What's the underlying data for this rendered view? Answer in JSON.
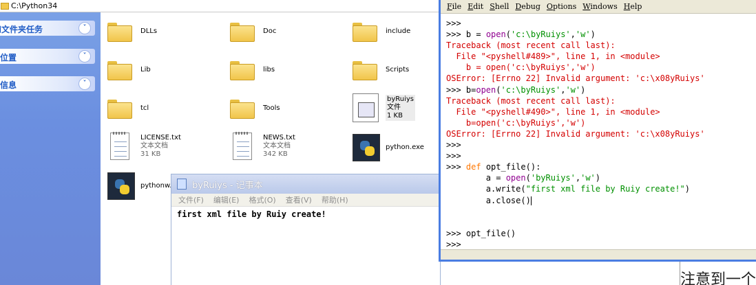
{
  "explorer": {
    "address": "C:\\Python34",
    "tasks": [
      {
        "label": "件和文件夹任务"
      },
      {
        "label": "其它位置"
      },
      {
        "label": "详细信息"
      }
    ],
    "files": [
      {
        "name": "DLLs",
        "type": "folder"
      },
      {
        "name": "Doc",
        "type": "folder"
      },
      {
        "name": "include",
        "type": "folder"
      },
      {
        "name": "Lib",
        "type": "folder"
      },
      {
        "name": "libs",
        "type": "folder"
      },
      {
        "name": "Scripts",
        "type": "folder"
      },
      {
        "name": "tcl",
        "type": "folder"
      },
      {
        "name": "Tools",
        "type": "folder"
      },
      {
        "name": "byRuiys",
        "type": "file",
        "kind": "文件",
        "size": "1 KB"
      },
      {
        "name": "LICENSE.txt",
        "type": "text",
        "kind": "文本文档",
        "size": "31 KB"
      },
      {
        "name": "NEWS.txt",
        "type": "text",
        "kind": "文本文档",
        "size": "342 KB"
      },
      {
        "name": "python.exe",
        "type": "exe"
      },
      {
        "name": "pythonw.",
        "type": "exe"
      }
    ]
  },
  "notepad": {
    "title": "byRuiys - 记事本",
    "menu": [
      "文件(F)",
      "编辑(E)",
      "格式(O)",
      "查看(V)",
      "帮助(H)"
    ],
    "content": "first xml file by Ruiy create!"
  },
  "idle": {
    "menu": [
      "File",
      "Edit",
      "Shell",
      "Debug",
      "Options",
      "Windows",
      "Help"
    ],
    "lines": [
      {
        "p": ">>>",
        "t": ""
      },
      {
        "p": ">>> ",
        "t": "b = open('c:\\byRuiys','w')"
      },
      {
        "p": "",
        "t": "Traceback (most recent call last):"
      },
      {
        "p": "",
        "t": "  File \"<pyshell#489>\", line 1, in <module>"
      },
      {
        "p": "",
        "t": "    b = open('c:\\byRuiys','w')"
      },
      {
        "p": "",
        "t": "OSError: [Errno 22] Invalid argument: 'c:\\x08yRuiys'"
      },
      {
        "p": ">>> ",
        "t": "b=open('c:\\byRuiys','w')"
      },
      {
        "p": "",
        "t": "Traceback (most recent call last):"
      },
      {
        "p": "",
        "t": "  File \"<pyshell#490>\", line 1, in <module>"
      },
      {
        "p": "",
        "t": "    b=open('c:\\byRuiys','w')"
      },
      {
        "p": "",
        "t": "OSError: [Errno 22] Invalid argument: 'c:\\x08yRuiys'"
      },
      {
        "p": ">>>",
        "t": ""
      },
      {
        "p": ">>>",
        "t": ""
      },
      {
        "p": ">>> ",
        "t": "def opt_file():"
      },
      {
        "p": "",
        "t": "        a = open('byRuiys','w')"
      },
      {
        "p": "",
        "t": "        a.write(\"first xml file by Ruiy create!\")"
      },
      {
        "p": "",
        "t": "        a.close()"
      },
      {
        "p": "",
        "t": ""
      },
      {
        "p": "",
        "t": ""
      },
      {
        "p": ">>> ",
        "t": "opt_file()"
      },
      {
        "p": ">>>",
        "t": ""
      }
    ]
  },
  "background_doc": {
    "text": "注意到一个"
  },
  "colors": {
    "accent": "#4a7de2",
    "error": "#d40000",
    "string": "#009000",
    "keyword": "#ff7700",
    "builtin": "#900090"
  }
}
